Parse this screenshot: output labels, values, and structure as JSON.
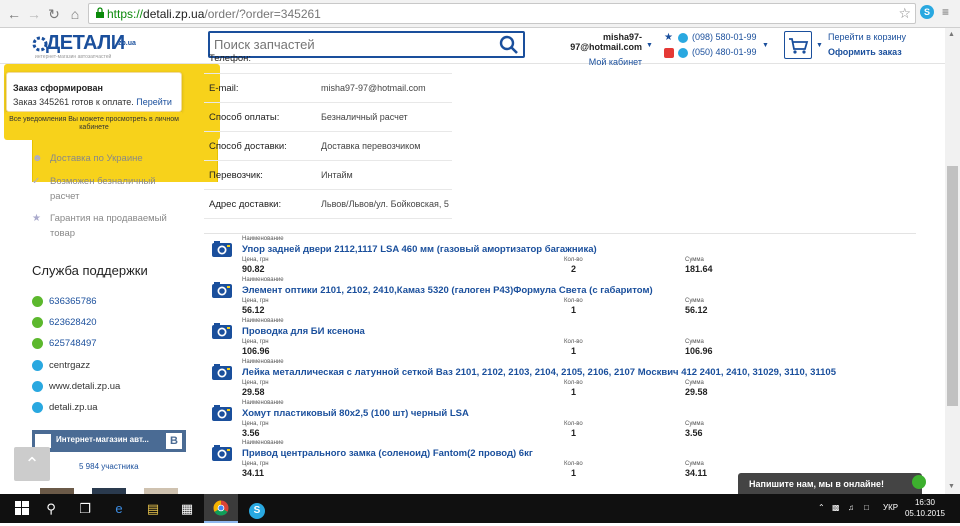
{
  "browser": {
    "url_scheme": "https://",
    "url_host": "detali.zp.ua",
    "url_path": "/order/?order=345261",
    "back_icon": "arrow-left-icon",
    "forward_icon": "arrow-right-icon",
    "reload_icon": "reload-icon",
    "home_icon": "home-icon"
  },
  "header": {
    "logo_text": "ДЕТАЛИ",
    "logo_domain": "zp.ua",
    "logo_sub": "интернет-магазин автозапчастей",
    "search_placeholder": "Поиск запчастей",
    "account_email": "misha97-97@hotmail.com",
    "account_link": "Мой кабинет",
    "phone1": "(098) 580-01-99",
    "phone2": "(050) 480-01-99",
    "cart_link": "Перейти в корзину",
    "checkout_link": "Оформить заказ"
  },
  "sidebar": {
    "notice_title": "Заказ сформирован",
    "notice_text_prefix": "Заказ 345261 готов к оплате.",
    "notice_link": "Перейти",
    "notice_footer": "Все уведомления Вы можете просмотреть в личном кабинете",
    "features": [
      {
        "label": "Доставка по Украине"
      },
      {
        "label": "Возможен безналичный"
      },
      {
        "label": "расчет"
      },
      {
        "label": "Гарантия на продаваемый"
      },
      {
        "label": "товар"
      }
    ],
    "support_title": "Служба поддержки",
    "contacts": [
      {
        "label": "636365786"
      },
      {
        "label": "623628420"
      },
      {
        "label": "625748497"
      },
      {
        "label": "centrgazz"
      },
      {
        "label": "www.detali.zp.ua"
      },
      {
        "label": "detali.zp.ua"
      }
    ],
    "vk_title": "Интернет-магазин авт...",
    "vk_badge": "В",
    "vk_subscribers": "5 984 участника"
  },
  "order": {
    "fields": [
      {
        "label": "E-mail:",
        "value": "misha97-97@hotmail.com"
      },
      {
        "label": "Способ оплаты:",
        "value": "Безналичный расчет"
      },
      {
        "label": "Способ доставки:",
        "value": "Доставка перевозчиком"
      },
      {
        "label": "Перевозчик:",
        "value": "Интайм"
      },
      {
        "label": "Адрес доставки:",
        "value": "Львов/Львов/ул. Бойковская, 5"
      }
    ],
    "partial_label": "Телефон:",
    "col_name": "Наименование",
    "col_price": "Цена, грн",
    "col_qty": "Кол-во",
    "col_sum": "Сумма",
    "items": [
      {
        "name": "Упор задней двери 2112,1117 LSA 460 мм (газовый амортизатор багажника)",
        "price": "90.82",
        "qty": "2",
        "sum": "181.64"
      },
      {
        "name": "Элемент оптики 2101, 2102, 2410,Камаз 5320 (галоген Р43)Формула Света (с габаритом)",
        "price": "56.12",
        "qty": "1",
        "sum": "56.12"
      },
      {
        "name": "Проводка для БИ ксенона",
        "price": "106.96",
        "qty": "1",
        "sum": "106.96"
      },
      {
        "name": "Лейка металлическая с латунной сеткой Ваз 2101, 2102, 2103, 2104, 2105, 2106, 2107 Москвич 412 2401, 2410, 31029, 3110, 31105",
        "price": "29.58",
        "qty": "1",
        "sum": "29.58"
      },
      {
        "name": "Хомут пластиковый 80х2,5 (100 шт) черный LSA",
        "price": "3.56",
        "qty": "1",
        "sum": "3.56"
      },
      {
        "name": "Привод центрального замка (соленоид) Fantom(2 провод) 6кг",
        "price": "34.11",
        "qty": "1",
        "sum": "34.11"
      }
    ]
  },
  "chat": {
    "label": "Напишите нам, мы в онлайне!"
  },
  "taskbar": {
    "lang": "УКР",
    "time": "16:30",
    "date": "05.10.2015"
  }
}
